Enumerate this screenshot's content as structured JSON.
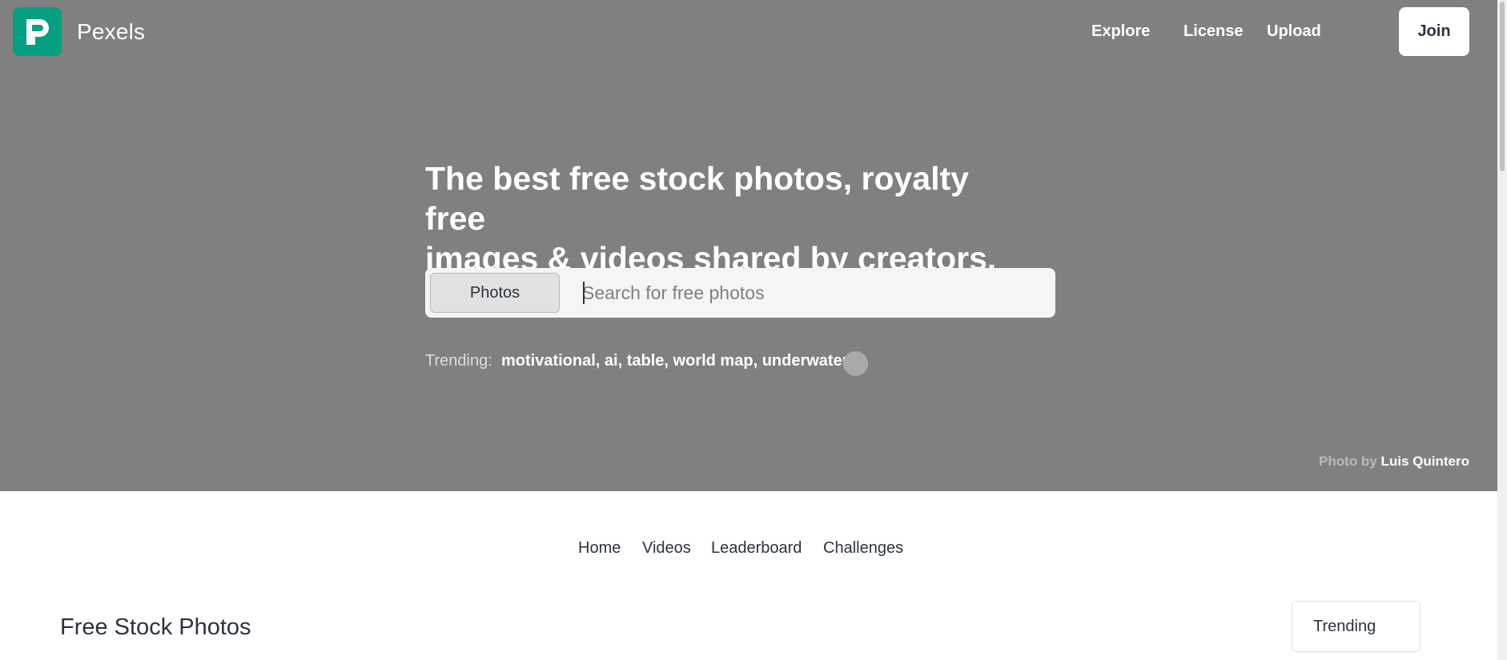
{
  "brand": {
    "name": "Pexels",
    "logo_letter": "P",
    "accent_color": "#05a081"
  },
  "topnav": {
    "links": [
      "Explore",
      "License",
      "Upload"
    ],
    "join_label": "Join"
  },
  "hero": {
    "headline_line1": "The best free stock photos, royalty free",
    "headline_line2": "images & videos shared by creators.",
    "search": {
      "type_label": "Photos",
      "placeholder": "Search for free photos",
      "value": ""
    },
    "trending_label": "Trending:",
    "trending_terms": [
      "motivational",
      "ai",
      "table",
      "world map",
      "underwater"
    ],
    "credit_prefix": "Photo by",
    "credit_author": "Luis Quintero"
  },
  "subnav": {
    "items": [
      "Home",
      "Videos",
      "Leaderboard",
      "Challenges"
    ]
  },
  "main": {
    "section_title": "Free Stock Photos",
    "sort_selected": "Trending"
  },
  "icons": {
    "logo": "pexels-logo-icon",
    "more": "more-dot-icon"
  }
}
